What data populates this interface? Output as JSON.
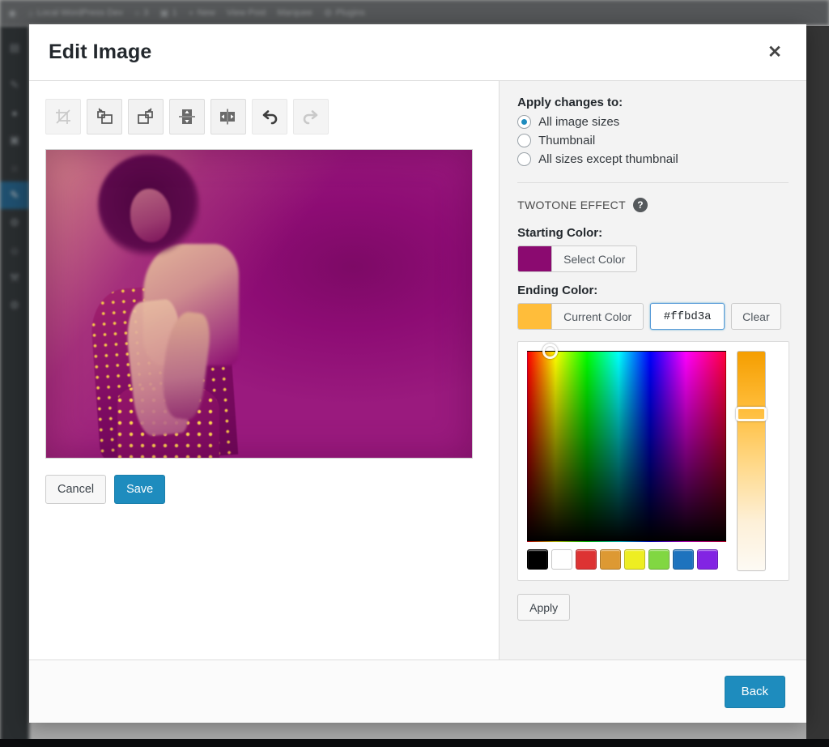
{
  "admin_bar": {
    "items": [
      {
        "icon": "wordpress-logo-icon",
        "label": ""
      },
      {
        "icon": "home-icon",
        "label": "Local WordPress Dev"
      },
      {
        "icon": "comment-icon",
        "label": "3"
      },
      {
        "icon": "updates-icon",
        "label": "1"
      },
      {
        "icon": "plus-icon",
        "label": "New"
      },
      {
        "icon": "",
        "label": "View Post"
      },
      {
        "icon": "",
        "label": "Marquee"
      },
      {
        "icon": "plugin-icon",
        "label": "Plugins"
      }
    ]
  },
  "sidebar": {
    "items": [
      {
        "icon": "dashboard-icon",
        "active": false
      },
      {
        "icon": "posts-icon",
        "active": false
      },
      {
        "icon": "media-icon",
        "active": false
      },
      {
        "icon": "pages-icon",
        "active": false
      },
      {
        "icon": "comments-icon",
        "active": false
      },
      {
        "icon": "appearance-icon",
        "active": true
      },
      {
        "icon": "plugins-icon",
        "active": false
      },
      {
        "icon": "users-icon",
        "active": false
      },
      {
        "icon": "tools-icon",
        "active": false
      },
      {
        "icon": "settings-icon",
        "active": false
      }
    ]
  },
  "modal": {
    "title": "Edit Image",
    "close_label": "✕"
  },
  "toolbar": {
    "buttons": [
      {
        "name": "crop-icon",
        "title": "Crop",
        "enabled": false
      },
      {
        "name": "rotate-left-icon",
        "title": "Rotate left",
        "enabled": true
      },
      {
        "name": "rotate-right-icon",
        "title": "Rotate right",
        "enabled": true
      },
      {
        "name": "flip-vertical-icon",
        "title": "Flip vertical",
        "enabled": true
      },
      {
        "name": "flip-horizontal-icon",
        "title": "Flip horizontal",
        "enabled": true
      },
      {
        "name": "undo-icon",
        "title": "Undo",
        "enabled": true
      },
      {
        "name": "redo-icon",
        "title": "Redo",
        "enabled": false
      }
    ]
  },
  "editor": {
    "image_alt": "Duotone portrait of a woman with an afro wearing a polka-dot dress",
    "cancel_label": "Cancel",
    "save_label": "Save"
  },
  "settings": {
    "apply_changes_label": "Apply changes to:",
    "apply_options": [
      {
        "label": "All image sizes",
        "checked": true
      },
      {
        "label": "Thumbnail",
        "checked": false
      },
      {
        "label": "All sizes except thumbnail",
        "checked": false
      }
    ],
    "section_title": "TWOTONE EFFECT",
    "help_glyph": "?",
    "starting_color": {
      "label": "Starting Color:",
      "button_label": "Select Color",
      "value": "#8b0a70"
    },
    "ending_color": {
      "label": "Ending Color:",
      "button_label": "Current Color",
      "value": "#ffbd3a",
      "hex_value": "#ffbd3a",
      "clear_label": "Clear"
    },
    "picker": {
      "swatches": [
        "#000000",
        "#ffffff",
        "#dd3333",
        "#dd9933",
        "#eeee22",
        "#81d742",
        "#1e73be",
        "#8224e3"
      ],
      "marker_hex": "#ffbd3a",
      "slider_top_color": "#f59e00",
      "slider_bottom_color": "#fdfaf4"
    },
    "apply_label": "Apply"
  },
  "footer": {
    "back_label": "Back"
  }
}
